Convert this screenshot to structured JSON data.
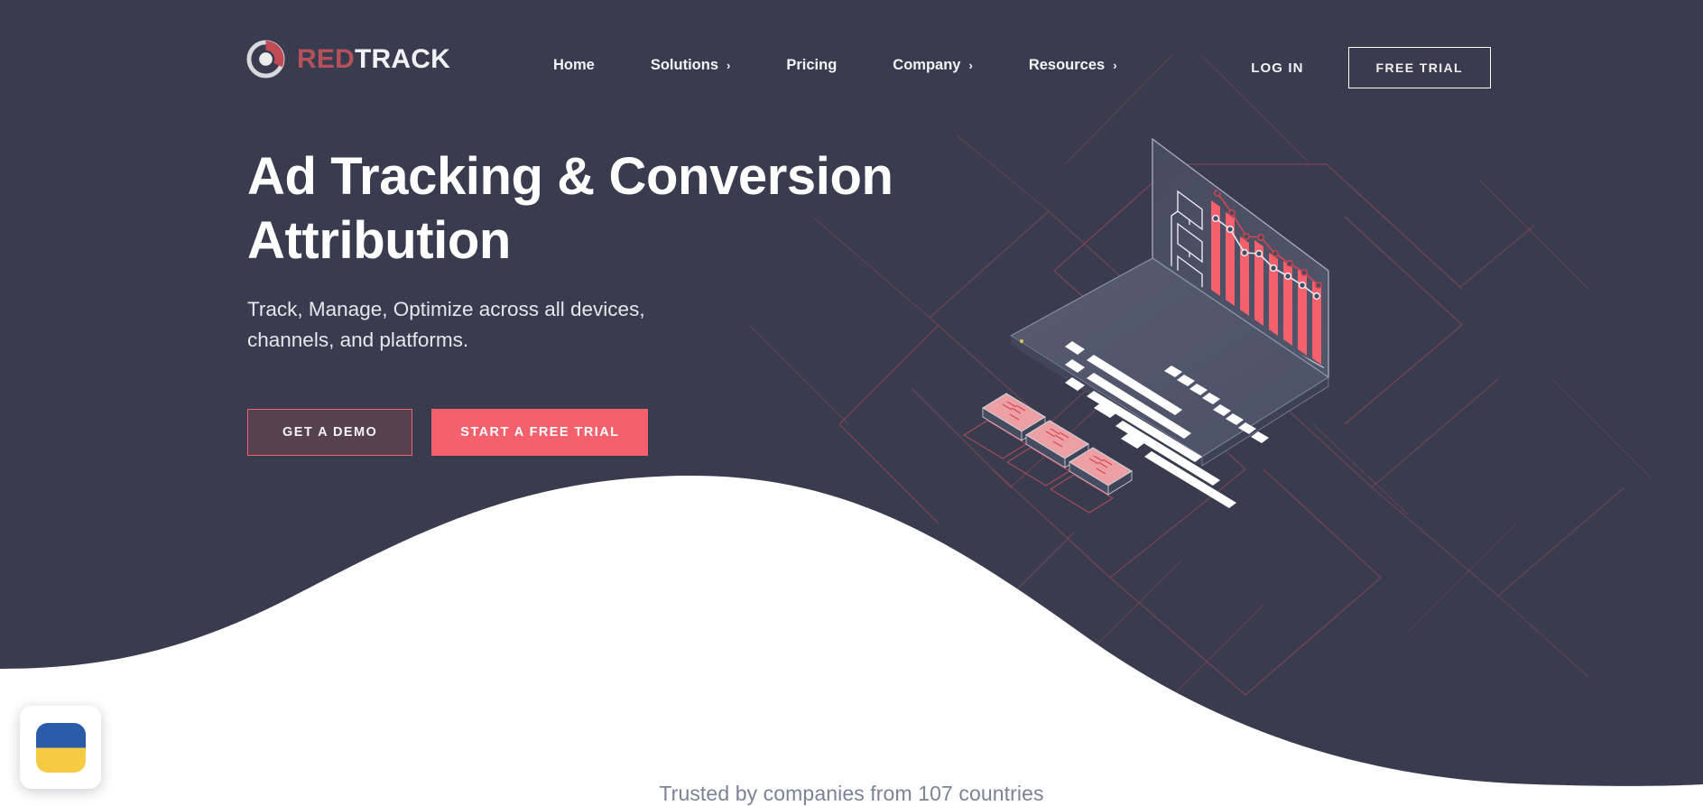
{
  "site": {
    "brand_red_word": "RED",
    "brand_white_word": "TRACK",
    "logo_icon": "redtrack-donut-logo-icon"
  },
  "colors": {
    "background": "#383c4e",
    "accent_coral": "#f4606c",
    "brand_red": "#b8505c",
    "demo_button_fill": "#55414f",
    "wave_white": "#ffffff",
    "trusted_text": "#7c8396",
    "flag_blue": "#2a5caa",
    "flag_yellow": "#f5cb43",
    "laptop_body": "#565b72",
    "laptop_screen": "#474c61"
  },
  "nav": {
    "items": [
      {
        "label": "Home",
        "has_chevron": false,
        "chevron": ""
      },
      {
        "label": "Solutions",
        "has_chevron": true,
        "chevron": "›"
      },
      {
        "label": "Pricing",
        "has_chevron": false,
        "chevron": ""
      },
      {
        "label": "Company",
        "has_chevron": true,
        "chevron": "›"
      },
      {
        "label": "Resources",
        "has_chevron": true,
        "chevron": "›"
      }
    ]
  },
  "auth": {
    "login_label": "LOG IN",
    "free_trial_label": "FREE TRIAL"
  },
  "hero": {
    "headline": "Ad Tracking & Conversion Attribution",
    "subtitle": "Track, Manage, Optimize across all devices, channels, and platforms.",
    "primary_cta": "START A FREE TRIAL",
    "secondary_cta": "GET A DEMO"
  },
  "footer_band": {
    "trusted_text": "Trusted by companies from 107 countries",
    "country_count": 107
  },
  "flag_widget": {
    "icon": "ukraine-flag-icon",
    "top_color": "#2a5caa",
    "bottom_color": "#f5cb43"
  },
  "illustration": {
    "name": "isometric-laptop-analytics-illustration",
    "chart_data": {
      "type": "bar",
      "title": "",
      "categories": [
        "1",
        "2",
        "3",
        "4",
        "5",
        "6",
        "7",
        "8"
      ],
      "values": [
        92,
        74,
        52,
        47,
        38,
        31,
        24,
        17
      ],
      "series": [
        {
          "name": "bars",
          "values": [
            92,
            74,
            52,
            47,
            38,
            31,
            24,
            17
          ]
        },
        {
          "name": "line-white",
          "values": [
            80,
            62,
            44,
            44,
            33,
            26,
            20,
            14
          ]
        },
        {
          "name": "line-red",
          "values": [
            100,
            85,
            58,
            57,
            40,
            34,
            27,
            19
          ]
        }
      ],
      "xlabel": "",
      "ylabel": "",
      "ylim": [
        0,
        100
      ],
      "grid": false,
      "legend": "none",
      "bar_color": "#f4606c",
      "line_white_color": "#e9eaef",
      "line_red_color": "#d9434f"
    },
    "screen_boxes": 3,
    "keyboard_rows": 6,
    "device_chips": 3
  }
}
